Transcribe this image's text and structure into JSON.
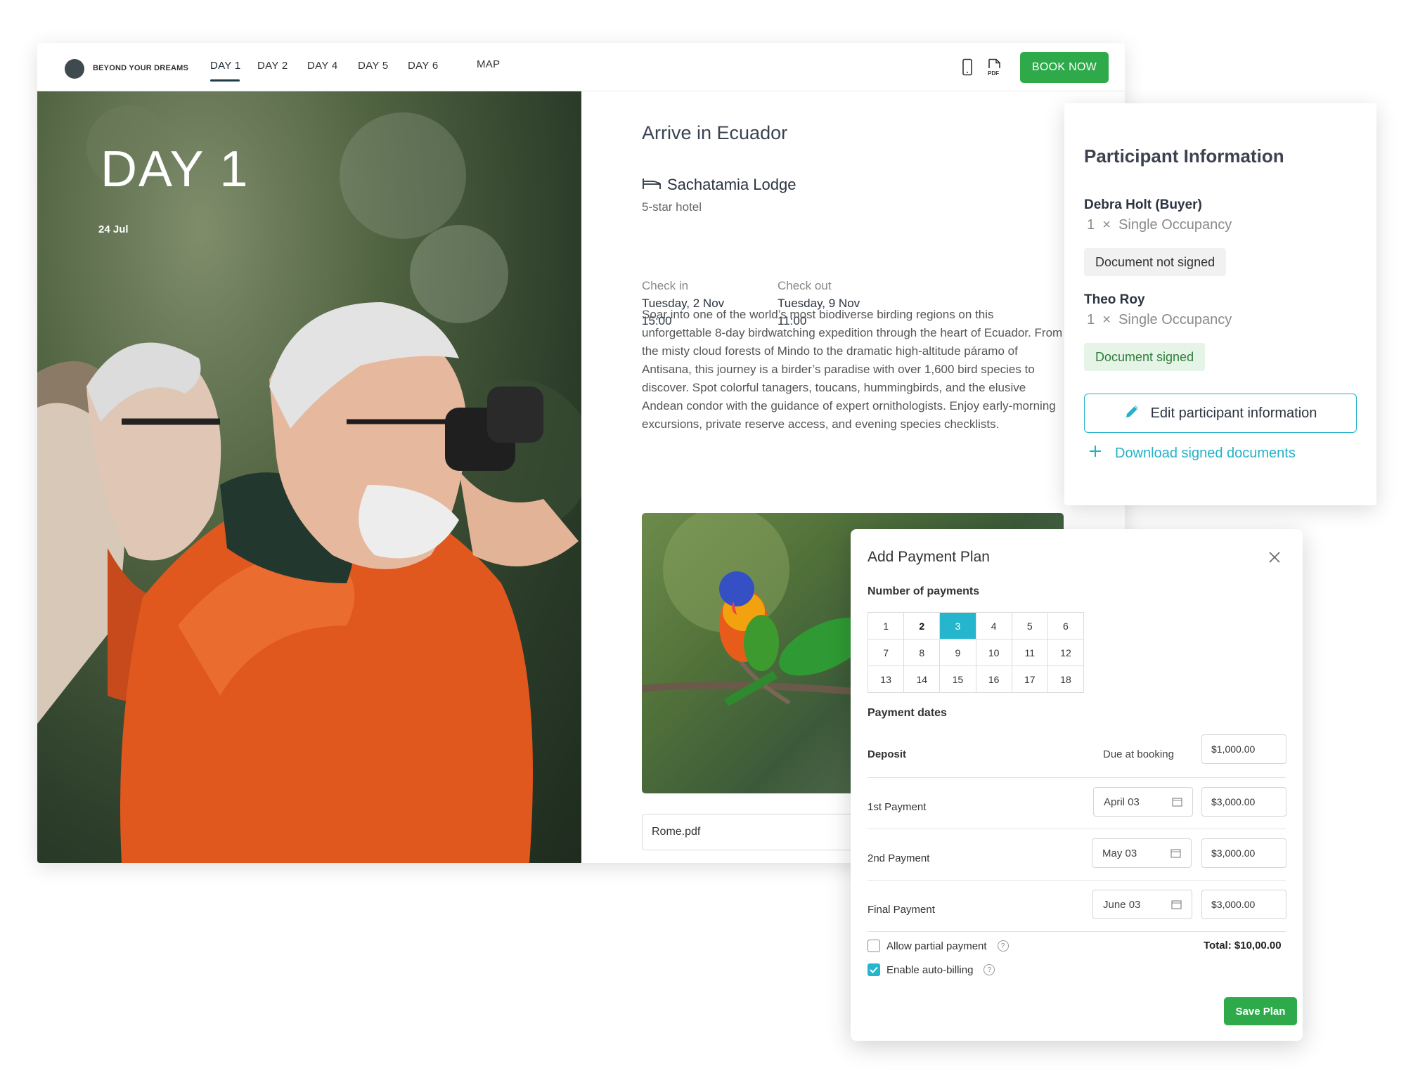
{
  "nav": {
    "brand": "BEYOND YOUR DREAMS",
    "tabs": [
      "DAY 1",
      "DAY 2",
      "DAY 4",
      "DAY 5",
      "DAY 6",
      "MAP"
    ],
    "active_tab": "DAY 1",
    "mobile_icon": "mobile-phone-icon",
    "pdf_icon": "pdf-icon",
    "pdf_icon_label": "PDF",
    "book_label": "BOOK NOW"
  },
  "hero": {
    "day_title": "DAY 1",
    "date": "24 Jul"
  },
  "itinerary": {
    "title": "Arrive in Ecuador",
    "lodge_icon": "bed-icon",
    "lodge_name": "Sachatamia Lodge",
    "hotel_type": "5-star hotel",
    "check_in_label": "Check in",
    "check_in_date": "Tuesday, 2 Nov",
    "check_in_time": "15:00",
    "check_out_label": "Check out",
    "check_out_date": "Tuesday, 9 Nov",
    "check_out_time": "11:00",
    "description": "Soar into one of the world’s most biodiverse birding regions on this unforgettable 8-day birdwatching expedition through the heart of Ecuador. From the misty cloud forests of Mindo to the dramatic high-altitude páramo of Antisana, this journey is a birder’s paradise with over 1,600 bird species to discover. Spot colorful tanagers, toucans, hummingbirds, and the elusive Andean condor with the guidance of expert ornithologists. Enjoy early-morning excursions, private reserve access, and evening species checklists.",
    "attachment": "Rome.pdf"
  },
  "participants": {
    "title": "Participant Information",
    "people": [
      {
        "name": "Debra Holt (Buyer)",
        "qty": "1",
        "times": "×",
        "occupancy": "Single Occupancy",
        "status": "Document not signed",
        "status_color": "#f1f1f1"
      },
      {
        "name": "Theo Roy",
        "qty": "1",
        "times": "×",
        "occupancy": "Single Occupancy",
        "status": "Document signed",
        "status_color": "#e5f4e6"
      }
    ],
    "edit_label": "Edit participant information",
    "edit_icon": "pencil-icon",
    "download_label": "Download signed documents",
    "download_icon": "plus-icon"
  },
  "payment_plan": {
    "title": "Add Payment Plan",
    "close_icon": "close-icon",
    "number_label": "Number of payments",
    "options": [
      [
        "1",
        "2",
        "3",
        "4",
        "5",
        "6"
      ],
      [
        "7",
        "8",
        "9",
        "10",
        "11",
        "12"
      ],
      [
        "13",
        "14",
        "15",
        "16",
        "17",
        "18"
      ]
    ],
    "selected": "3",
    "dates_label": "Payment dates",
    "rows": [
      {
        "label": "Deposit",
        "due": "Due at booking",
        "date": "",
        "amount": "$1,000.00"
      },
      {
        "label": "1st Payment",
        "due": "",
        "date": "April 03",
        "amount": "$3,000.00"
      },
      {
        "label": "2nd Payment",
        "due": "",
        "date": "May 03",
        "amount": "$3,000.00"
      },
      {
        "label": "Final Payment",
        "due": "",
        "date": "June 03",
        "amount": "$3,000.00"
      }
    ],
    "partial_label": "Allow partial payment",
    "partial_checked": false,
    "autobill_label": "Enable auto-billing",
    "autobill_checked": true,
    "help_glyph": "?",
    "total": "Total: $10,00.00",
    "save_label": "Save Plan",
    "accent": "#25b6cd",
    "save_color": "#2faa4a"
  }
}
